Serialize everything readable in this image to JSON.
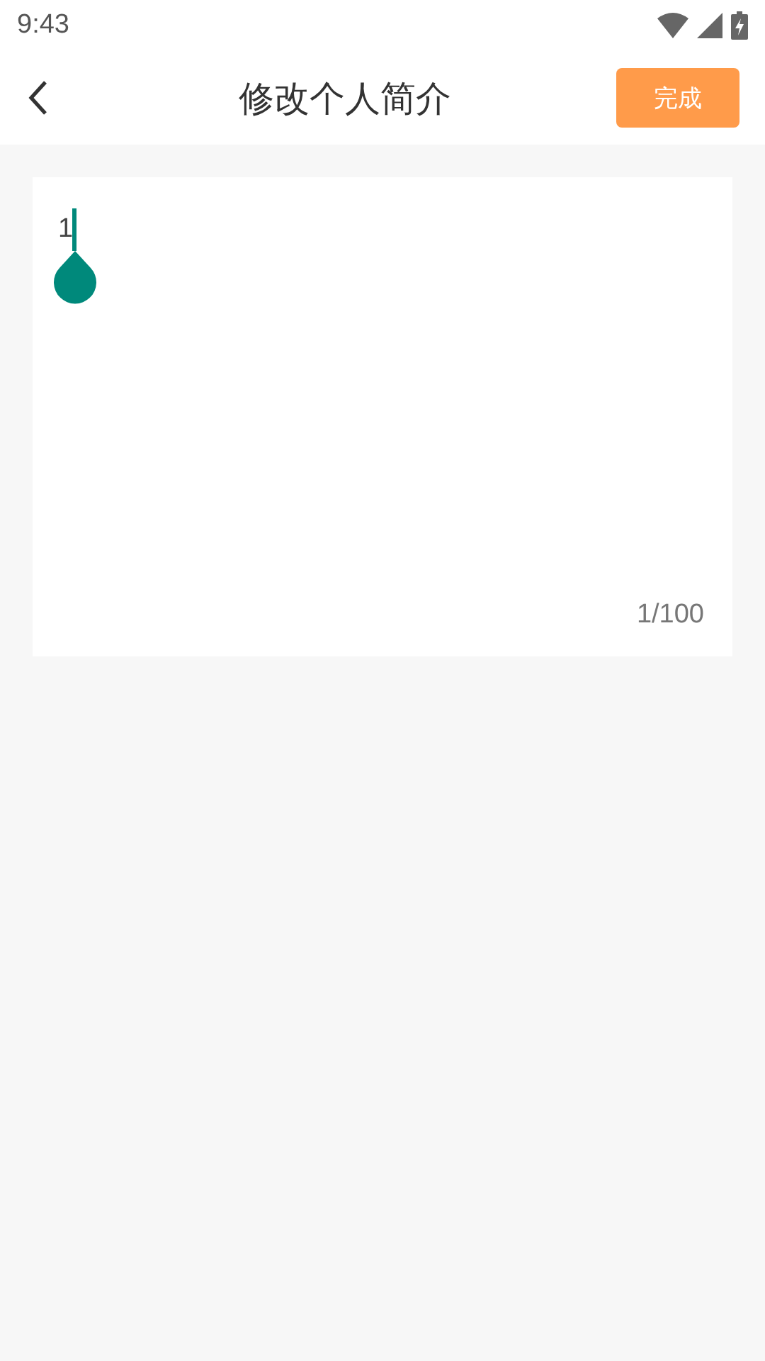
{
  "status_bar": {
    "time": "9:43"
  },
  "header": {
    "title": "修改个人简介",
    "done_button": "完成"
  },
  "editor": {
    "value": "1",
    "counter": "1/100"
  }
}
